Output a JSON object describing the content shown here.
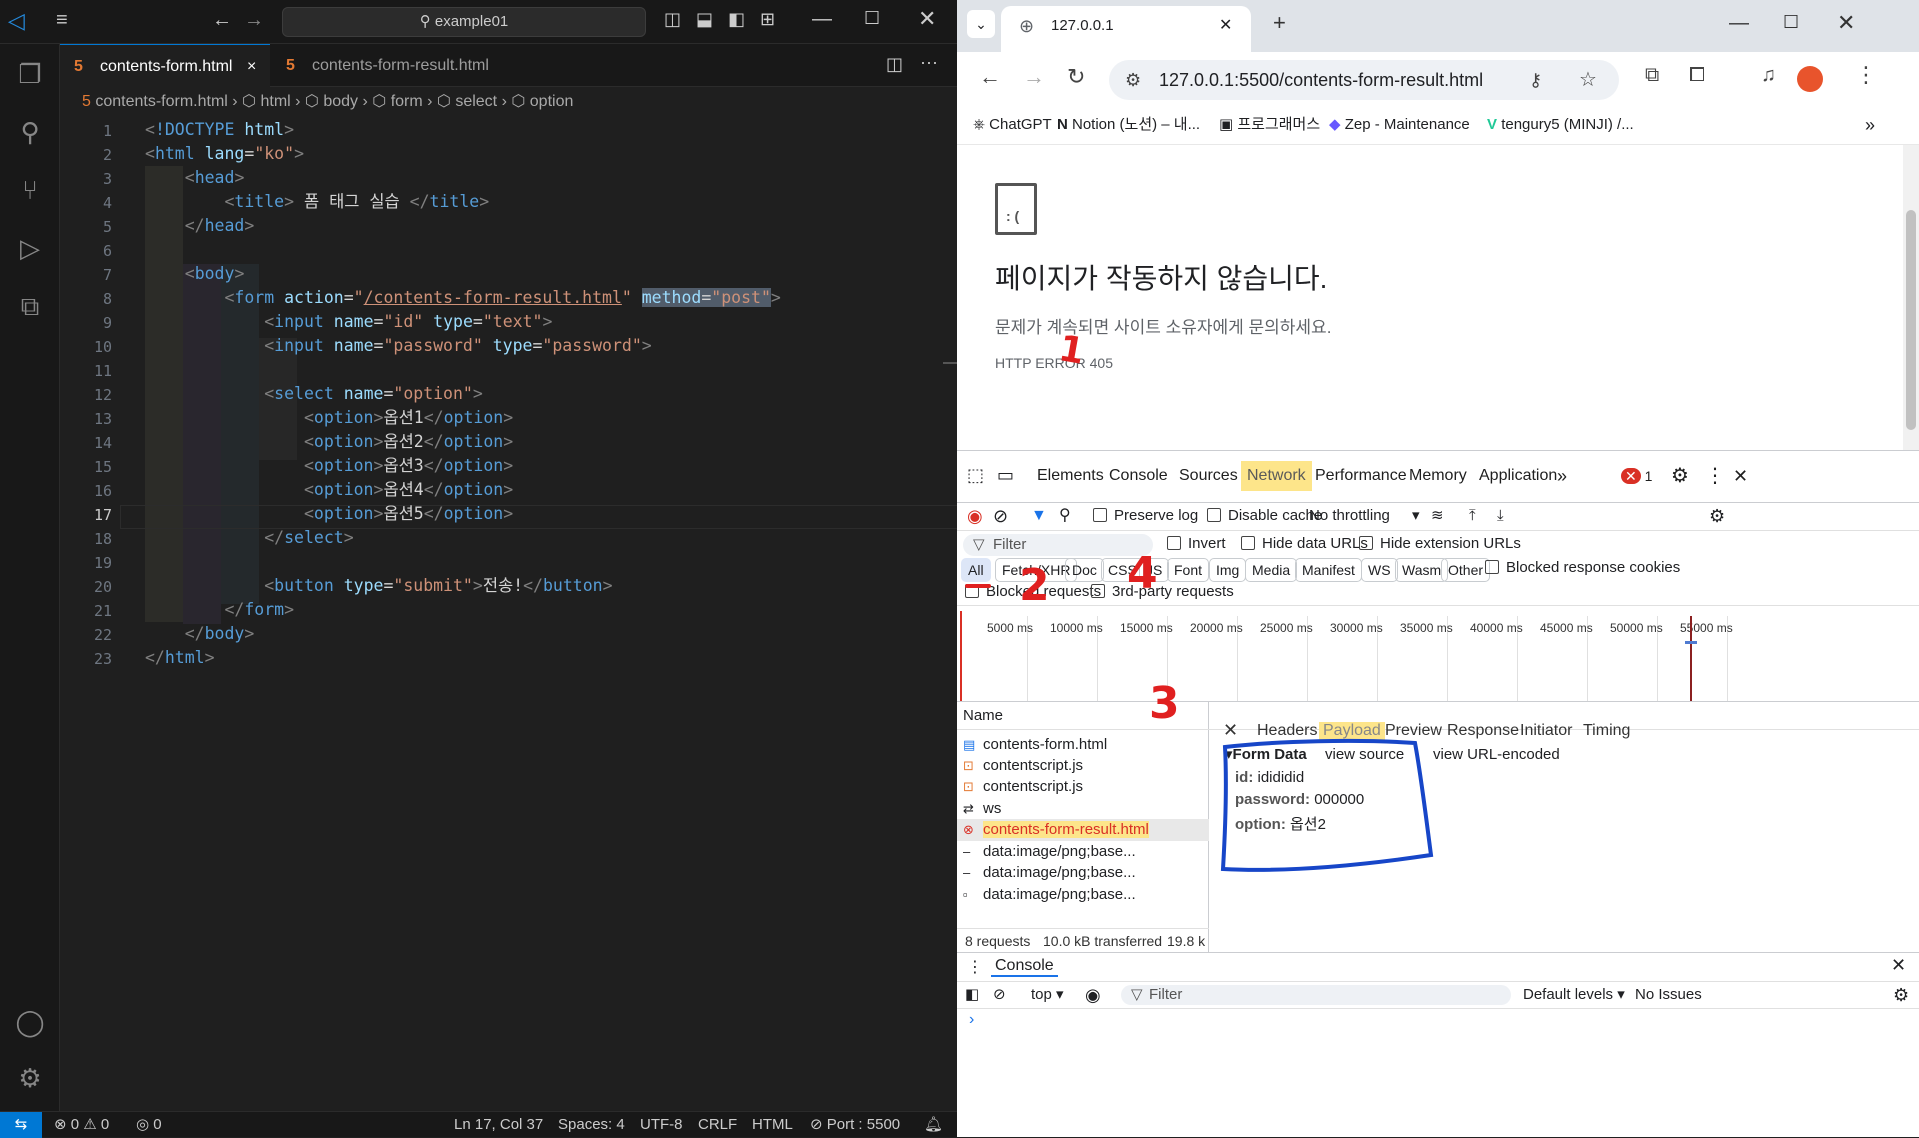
{
  "vscode": {
    "search_text": "example01",
    "tabs": [
      {
        "label": "contents-form.html",
        "close": "×"
      },
      {
        "label": "contents-form-result.html"
      }
    ],
    "breadcrumb": [
      "contents-form.html",
      "html",
      "body",
      "form",
      "select",
      "option"
    ],
    "line_numbers": [
      "1",
      "2",
      "3",
      "4",
      "5",
      "6",
      "7",
      "8",
      "9",
      "10",
      "11",
      "12",
      "13",
      "14",
      "15",
      "16",
      "17",
      "18",
      "19",
      "20",
      "21",
      "22",
      "23"
    ],
    "status": {
      "problems_errors": "0",
      "problems_warnings": "0",
      "ports": "0",
      "cursor": "Ln 17, Col 37",
      "spaces": "Spaces: 4",
      "encoding": "UTF-8",
      "eol": "CRLF",
      "language": "HTML",
      "port": "Port : 5500"
    }
  },
  "browser": {
    "tab_title": "127.0.0.1",
    "url": "127.0.0.1:5500/contents-form-result.html",
    "bookmarks": [
      "ChatGPT",
      "Notion (노션) – 내...",
      "프로그래머스",
      "Zep - Maintenance",
      "tengury5 (MINJI) /..."
    ],
    "error": {
      "heading": "페이지가 작동하지 않습니다.",
      "message": "문제가 계속되면 사이트 소유자에게 문의하세요.",
      "code": "HTTP ERROR 405"
    }
  },
  "devtools": {
    "tabs": [
      "Elements",
      "Console",
      "Sources",
      "Network",
      "Performance",
      "Memory",
      "Application"
    ],
    "more": "»",
    "error_count": "1",
    "toolbar": {
      "preserve_log": "Preserve log",
      "disable_cache": "Disable cache",
      "throttling": "No throttling"
    },
    "filter": {
      "placeholder": "Filter",
      "invert": "Invert",
      "hide_data": "Hide data URLs",
      "hide_ext": "Hide extension URLs"
    },
    "chips": [
      "All",
      "Fetch/XHR",
      "Doc",
      "CSS",
      "JS",
      "Font",
      "Img",
      "Media",
      "Manifest",
      "WS",
      "Wasm",
      "Other"
    ],
    "blocked_cookies": "Blocked response cookies",
    "blocked_requests": "Blocked requests",
    "third_party": "3rd-party requests",
    "timeline_ticks": [
      "5000 ms",
      "10000 ms",
      "15000 ms",
      "20000 ms",
      "25000 ms",
      "30000 ms",
      "35000 ms",
      "40000 ms",
      "45000 ms",
      "50000 ms",
      "55000 ms"
    ],
    "name_header": "Name",
    "requests": [
      "contents-form.html",
      "contentscript.js",
      "contentscript.js",
      "ws",
      "contents-form-result.html",
      "data:image/png;base...",
      "data:image/png;base...",
      "data:image/png;base..."
    ],
    "panel_tabs": [
      "Headers",
      "Payload",
      "Preview",
      "Response",
      "Initiator",
      "Timing"
    ],
    "form_data": {
      "title": "Form Data",
      "view_source": "view source",
      "view_url": "view URL-encoded",
      "fields": [
        {
          "key": "id:",
          "value": "idididid"
        },
        {
          "key": "password:",
          "value": "000000"
        },
        {
          "key": "option:",
          "value": "옵션2"
        }
      ]
    },
    "footer": {
      "requests": "8 requests",
      "transferred": "10.0 kB transferred",
      "resources": "19.8 k"
    },
    "console": {
      "tab": "Console",
      "context": "top",
      "filter": "Filter",
      "levels": "Default levels",
      "issues": "No Issues",
      "prompt": "›"
    }
  },
  "annotations": [
    "1",
    "2",
    "3",
    "4"
  ],
  "colors": {
    "network_highlight": "#fde58a",
    "annotation_red": "#e02020",
    "annotation_blue": "#1746c8"
  }
}
